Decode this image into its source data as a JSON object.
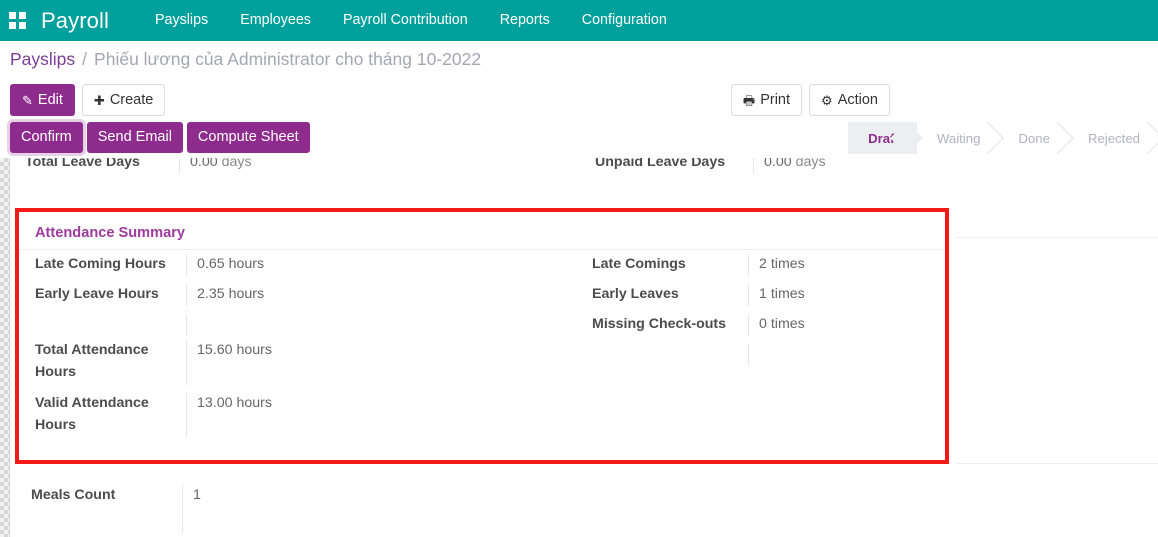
{
  "navbar": {
    "apps_icon": "apps-grid-icon",
    "brand": "Payroll",
    "menu": [
      {
        "label": "Payslips"
      },
      {
        "label": "Employees"
      },
      {
        "label": "Payroll Contribution"
      },
      {
        "label": "Reports"
      },
      {
        "label": "Configuration"
      }
    ],
    "bg_color": "#00A09D"
  },
  "breadcrumb": {
    "root": "Payslips",
    "separator": "/",
    "current": "Phiếu lương của Administrator cho tháng 10-2022"
  },
  "control_panel": {
    "edit_label": "Edit",
    "edit_icon": "pencil-icon",
    "create_label": "Create",
    "create_icon": "plus-icon",
    "print_label": "Print",
    "print_icon": "printer-icon",
    "action_label": "Action",
    "action_icon": "gear-icon"
  },
  "statusbar": {
    "buttons": [
      {
        "label": "Confirm",
        "style": "solid-focused"
      },
      {
        "label": "Send Email",
        "style": "solid"
      },
      {
        "label": "Compute Sheet",
        "style": "solid"
      }
    ],
    "pipeline": [
      {
        "label": "Draft",
        "active": true
      },
      {
        "label": "Waiting",
        "active": false
      },
      {
        "label": "Done",
        "active": false
      },
      {
        "label": "Rejected",
        "active": false
      }
    ],
    "active_color": "#8E2C8E"
  },
  "form": {
    "clipped_rows": [
      {
        "label": "Total Leave Days",
        "value": "0.00",
        "unit": "days"
      },
      {
        "label": "Unpaid Leave Days",
        "value": "0.00",
        "unit": "days"
      }
    ],
    "attendance_summary": {
      "title": "Attendance Summary",
      "highlight_color": "#f41a1a",
      "title_color": "#9E3A9E",
      "left_rows": [
        {
          "label": "Late Coming Hours",
          "value": "0.65",
          "unit": "hours"
        },
        {
          "label": "Early Leave Hours",
          "value": "2.35",
          "unit": "hours"
        },
        {
          "label": "Total Attendance Hours",
          "value": "15.60",
          "unit": "hours"
        },
        {
          "label": "Valid Attendance Hours",
          "value": "13.00",
          "unit": "hours"
        }
      ],
      "right_rows": [
        {
          "label": "Late Comings",
          "value": "2",
          "unit": "times"
        },
        {
          "label": "Early Leaves",
          "value": "1",
          "unit": "times"
        },
        {
          "label": "Missing Check-outs",
          "value": "0",
          "unit": "times"
        }
      ]
    },
    "meals": {
      "label": "Meals Count",
      "value": "1"
    }
  }
}
